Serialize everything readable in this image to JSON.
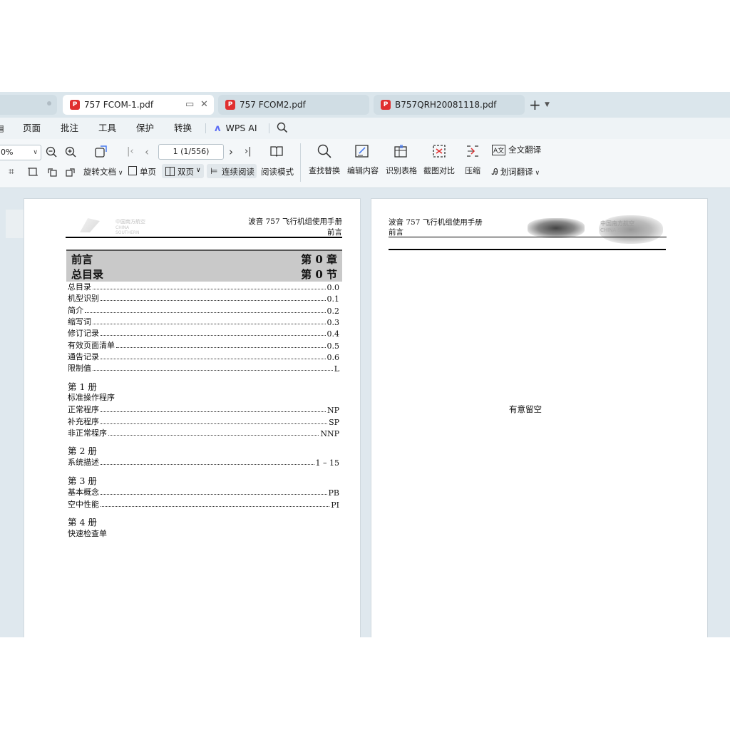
{
  "tabs": [
    {
      "label": "757 FCOM-1.pdf",
      "active": true
    },
    {
      "label": "757 FCOM2.pdf",
      "active": false
    },
    {
      "label": "B757QRH20081118.pdf",
      "active": false
    }
  ],
  "menu": [
    "页面",
    "批注",
    "工具",
    "保护",
    "转换",
    "WPS AI"
  ],
  "toolbar": {
    "zoom": "0%",
    "rotate": "旋转文档",
    "single_page": "单页",
    "double_page": "双页",
    "continuous": "连续阅读",
    "reading_mode": "阅读模式",
    "page_indicator": "1 (1/556)",
    "find_replace": "查找替换",
    "edit_content": "编辑内容",
    "recognize_table": "识别表格",
    "screenshot_compare": "截图对比",
    "compress": "压缩",
    "full_translate": "全文翻译",
    "word_translate": "划词翻译"
  },
  "left_page": {
    "header_title": "波音 757 飞行机组使用手册",
    "header_sub": "前言",
    "logo_cn": "中国南方航空",
    "logo_en": "CHINA SOUTHERN",
    "section": {
      "left1": "前言",
      "right1": "第 0 章",
      "left2": "总目录",
      "right2": "第 0 节"
    },
    "toc": [
      {
        "label": "总目录",
        "ref": "0.0"
      },
      {
        "label": "机型识别",
        "ref": "0.1"
      },
      {
        "label": "简介",
        "ref": "0.2"
      },
      {
        "label": "缩写词",
        "ref": "0.3"
      },
      {
        "label": "修订记录",
        "ref": "0.4"
      },
      {
        "label": "有效页面清单",
        "ref": "0.5"
      },
      {
        "label": "通告记录",
        "ref": "0.6"
      },
      {
        "label": "限制值",
        "ref": "L"
      }
    ],
    "vol1": {
      "title": "第 1 册",
      "subtitle": "标准操作程序",
      "items": [
        {
          "label": "正常程序",
          "ref": "NP"
        },
        {
          "label": "补充程序",
          "ref": "SP"
        },
        {
          "label": "非正常程序",
          "ref": "NNP"
        }
      ]
    },
    "vol2": {
      "title": "第 2 册",
      "items": [
        {
          "label": "系统描述",
          "ref": "1 – 15"
        }
      ]
    },
    "vol3": {
      "title": "第 3 册",
      "items": [
        {
          "label": "基本概念",
          "ref": "PB"
        },
        {
          "label": "空中性能",
          "ref": "PI"
        }
      ]
    },
    "vol4": {
      "title": "第 4 册",
      "subtitle": "快速检查单"
    }
  },
  "right_page": {
    "header_title": "波音 757 飞行机组使用手册",
    "header_sub": "前言",
    "logo_cn": "中国南方航空",
    "logo_en": "CHINA S",
    "blank_text": "有意留空"
  }
}
